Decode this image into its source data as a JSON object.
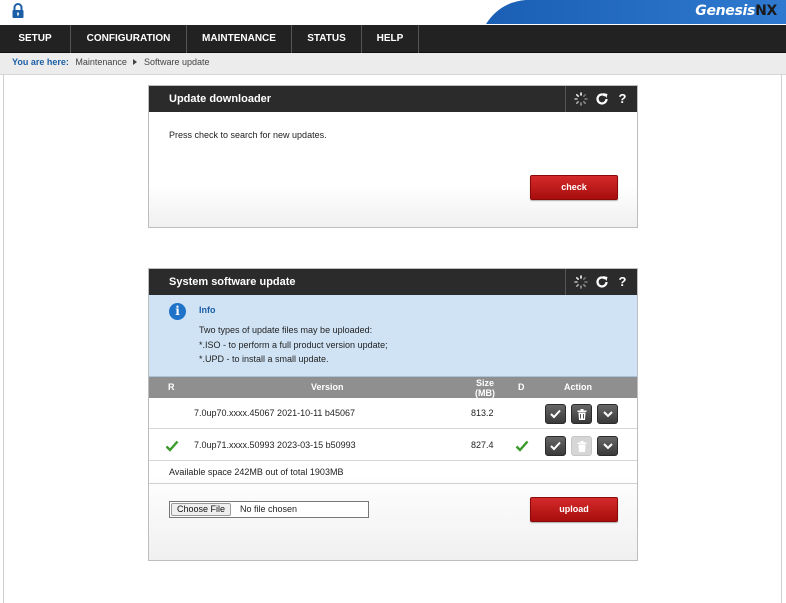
{
  "header": {
    "brand_main": "Genesis",
    "brand_suffix": "NX"
  },
  "nav": {
    "items": [
      "SETUP",
      "CONFIGURATION",
      "MAINTENANCE",
      "STATUS",
      "HELP"
    ]
  },
  "breadcrumb": {
    "label": "You are here:",
    "parent": "Maintenance",
    "current": "Software update"
  },
  "update_downloader": {
    "title": "Update downloader",
    "message": "Press check to search for new updates.",
    "check_button": "check"
  },
  "system_update": {
    "title": "System software update",
    "info": {
      "title": "Info",
      "lines": [
        "Two types of update files may be uploaded:",
        "*.ISO - to perform a full product version update;",
        "*.UPD - to install a small update."
      ]
    },
    "columns": {
      "r": "R",
      "version": "Version",
      "size_top": "Size",
      "size_bottom": "(MB)",
      "d": "D",
      "action": "Action"
    },
    "rows": [
      {
        "version": "7.0up70.xxxx.45067 2021-10-11 b45067",
        "size": "813.2",
        "r_checked": false,
        "d_checked": false,
        "delete_enabled": true
      },
      {
        "version": "7.0up71.xxxx.50993 2023-03-15 b50993",
        "size": "827.4",
        "r_checked": true,
        "d_checked": true,
        "delete_enabled": false
      }
    ],
    "available_space": "Available space 242MB out of total 1903MB",
    "file_button": "Choose File",
    "file_status": "No file chosen",
    "upload_button": "upload"
  },
  "colors": {
    "accent_blue": "#1d5fa6",
    "button_red": "#c01a1a",
    "check_green": "#3a9a2a",
    "info_bg": "#cfe3f5"
  },
  "icons": [
    "lock-icon",
    "spinner-icon",
    "refresh-icon",
    "help-icon",
    "info-icon",
    "checkmark-icon",
    "trash-icon",
    "chevron-down-icon"
  ]
}
